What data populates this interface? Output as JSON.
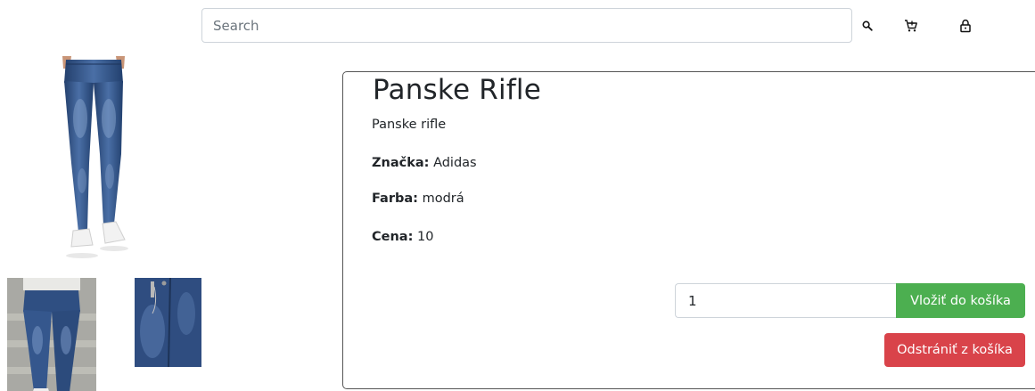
{
  "header": {
    "search_placeholder": "Search",
    "icons": [
      "search-icon",
      "cart-icon",
      "lock-icon"
    ]
  },
  "product": {
    "title": "Panske Rifle",
    "description": "Panske rifle",
    "brand_label": "Značka:",
    "brand_value": "Adidas",
    "color_label": "Farba:",
    "color_value": "modrá",
    "price_label": "Cena:",
    "price_value": "10"
  },
  "actions": {
    "quantity_value": "1",
    "add_label": "Vložiť do košíka",
    "remove_label": "Odstrániť z košíka"
  },
  "colors": {
    "add_button": "#4caf50",
    "remove_button": "#d9434a",
    "denim": "#2f4f82"
  }
}
